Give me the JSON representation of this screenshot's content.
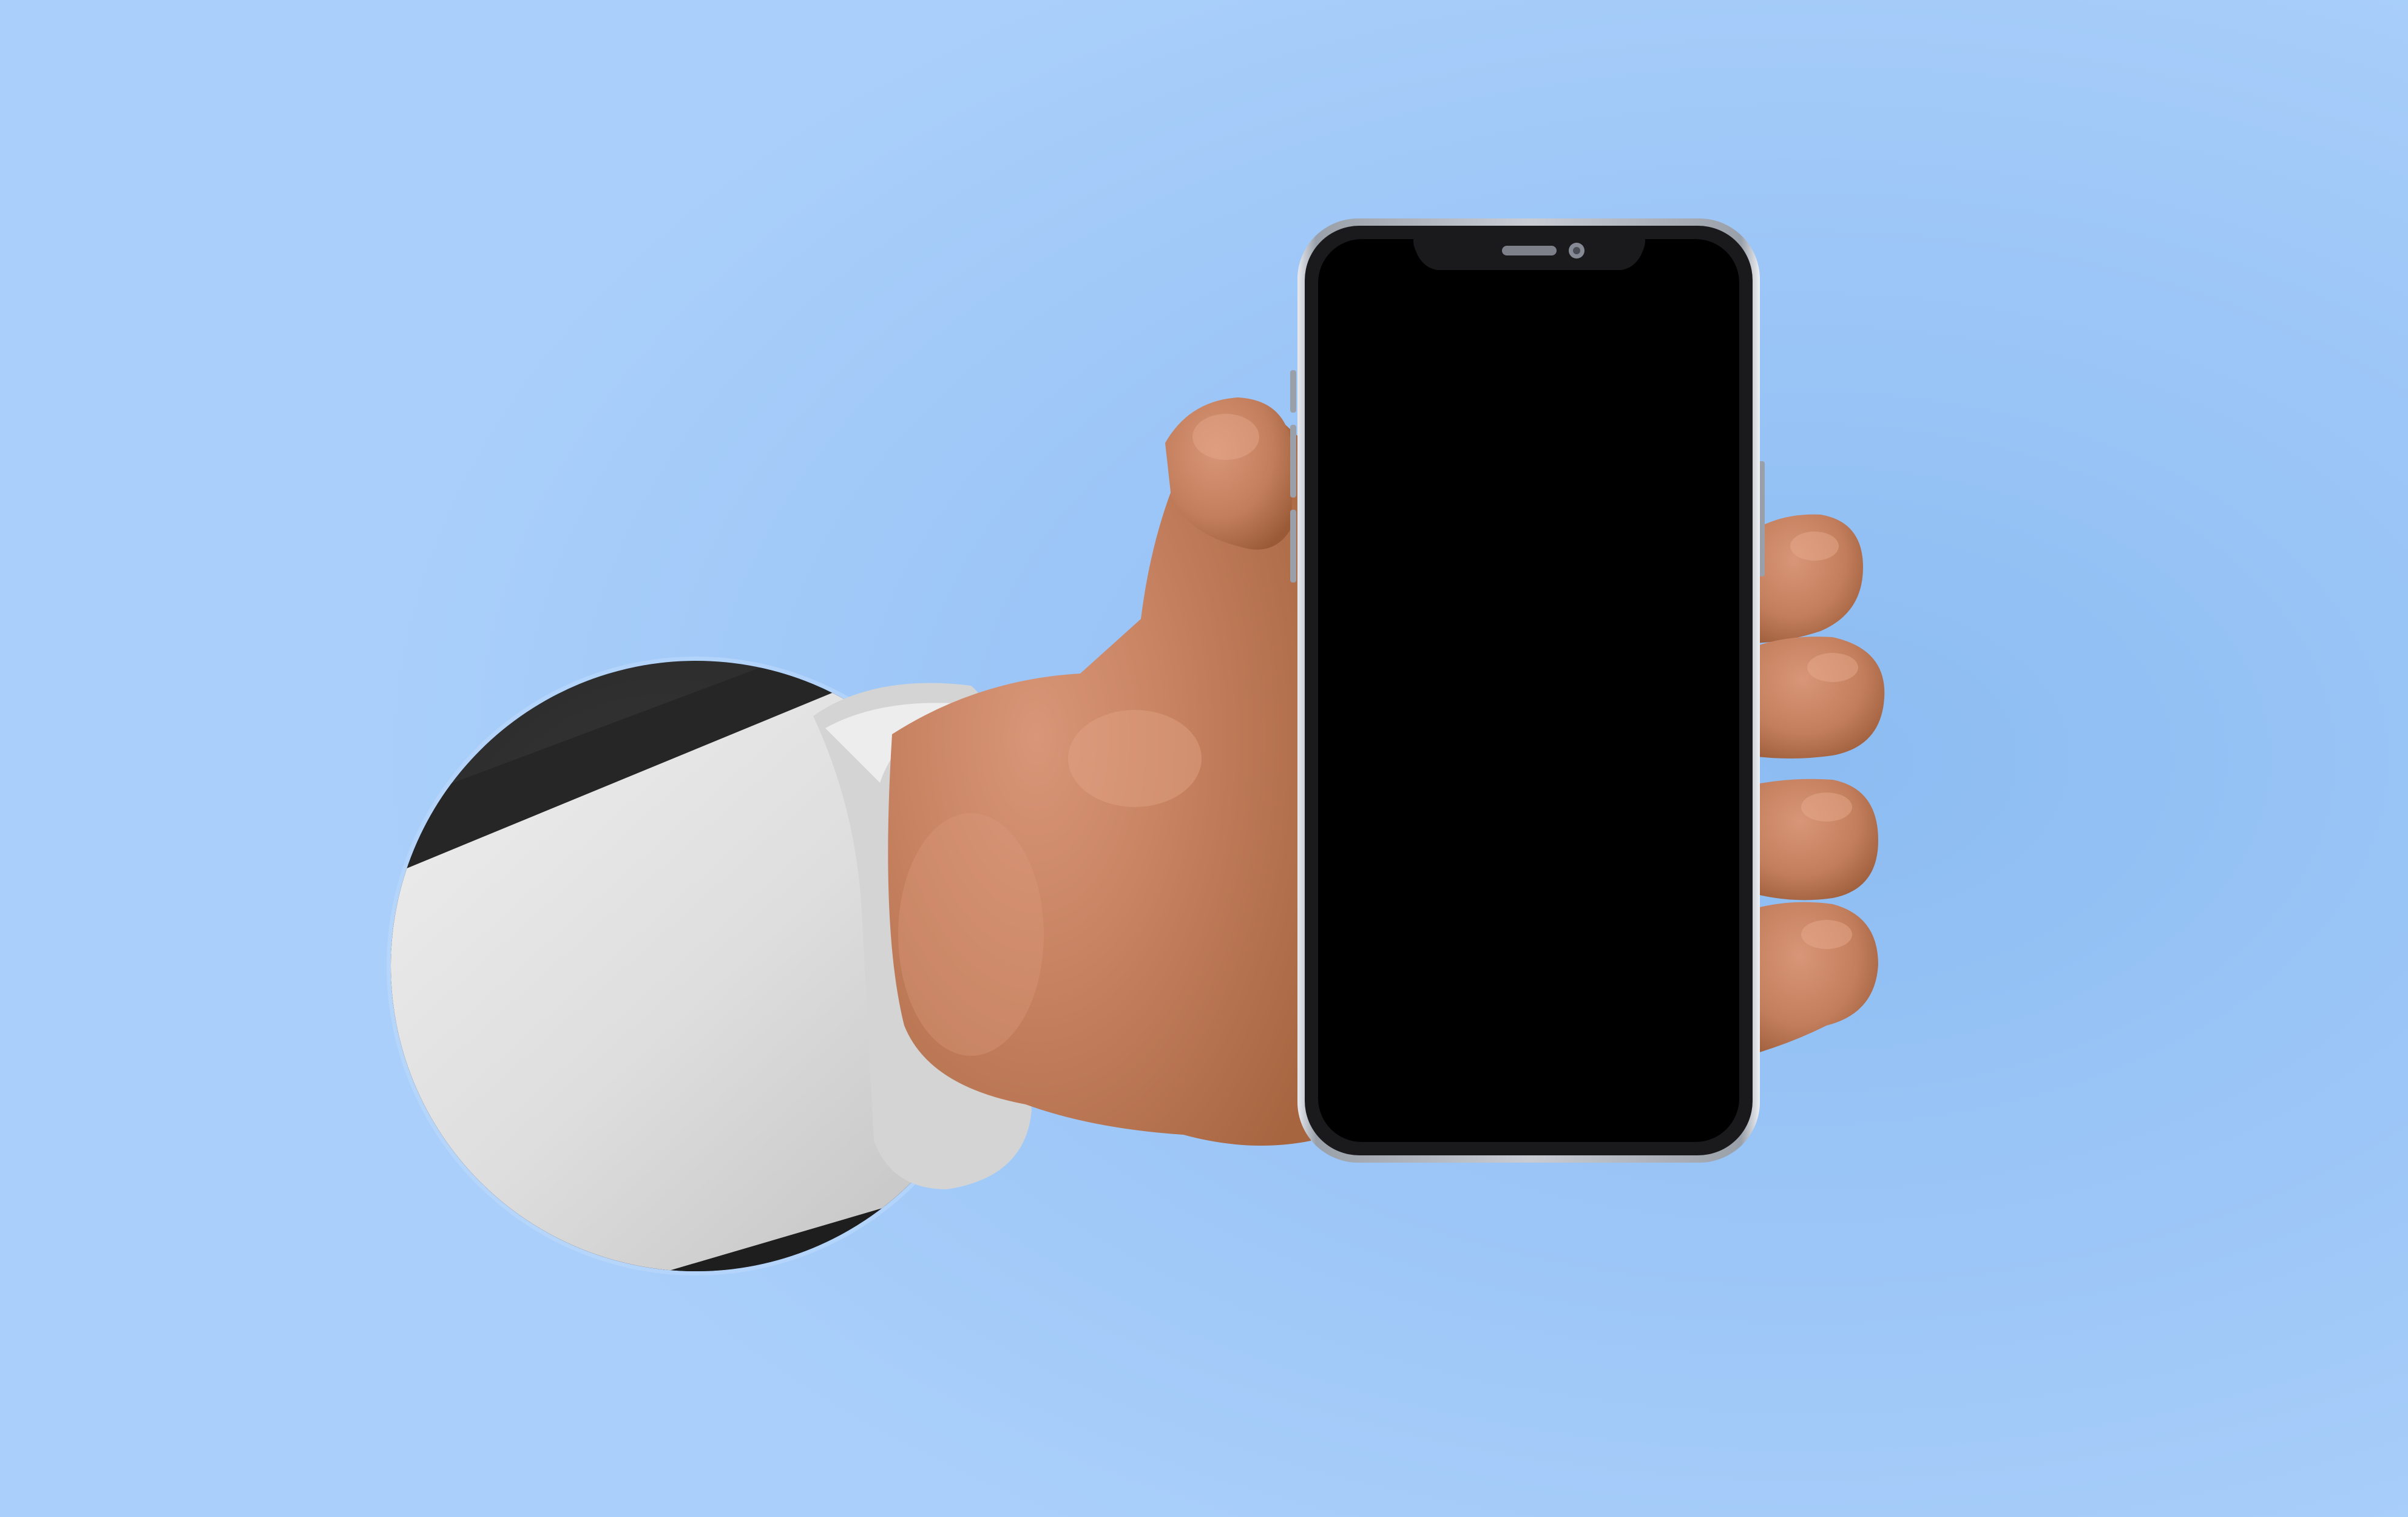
{
  "scene": {
    "background_color": "#a6cbf8",
    "background_glow_color": "#8fbef3",
    "hole_color": "#2f2f2f",
    "sleeve_color": "#e3e3e3",
    "skin_color": "#c27e5c",
    "skin_highlight_color": "#d99678",
    "phone_frame_color": "#c9ccd3",
    "phone_screen_color": "#000000",
    "phone_screen_content": ""
  }
}
